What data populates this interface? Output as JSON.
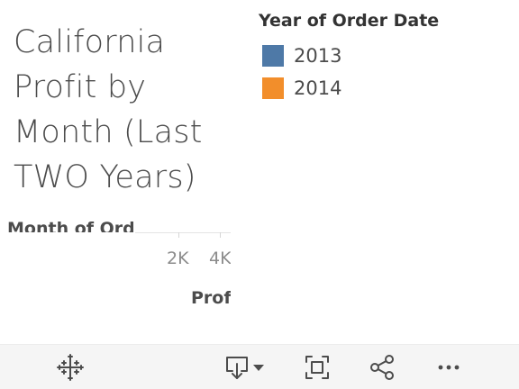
{
  "viz": {
    "title": "California\nProfit by\nMonth (Last\nTWO Years)",
    "legend": {
      "title": "Year of Order Date",
      "items": [
        {
          "label": "2013",
          "color": "#4e79a7"
        },
        {
          "label": "2014",
          "color": "#f28e2b"
        }
      ]
    },
    "row_header": "Month of Order Date",
    "axis": {
      "ticks": [
        "2K",
        "4K"
      ],
      "title": "Profit"
    }
  },
  "toolbar": {
    "icons": [
      "tableau-logo-icon",
      "download-icon",
      "chevron-down-icon",
      "fullscreen-icon",
      "share-icon",
      "more-icon"
    ]
  },
  "colors": {
    "toolbar_bg": "#f5f5f5",
    "icon": "#4c4c4c"
  }
}
